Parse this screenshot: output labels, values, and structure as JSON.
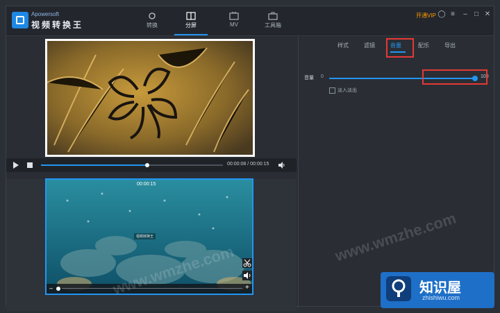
{
  "app": {
    "brand": "Apowersoft",
    "name": "视频转换王"
  },
  "tabs": [
    {
      "label": "转换",
      "active": false
    },
    {
      "label": "分屏",
      "active": true
    },
    {
      "label": "MV",
      "active": false
    },
    {
      "label": "工具箱",
      "active": false
    }
  ],
  "vip_label": "开通VIP",
  "player": {
    "time": "00:00:08 / 00:00:15"
  },
  "clip2": {
    "duration": "00:00:15",
    "mini_label": "视频转换王"
  },
  "subtabs": [
    {
      "label": "样式",
      "active": false
    },
    {
      "label": "滤镜",
      "active": false
    },
    {
      "label": "音量",
      "active": true
    },
    {
      "label": "配乐",
      "active": false
    },
    {
      "label": "导出",
      "active": false
    }
  ],
  "volume": {
    "label": "音量",
    "min": "0",
    "max": "100",
    "value": 100
  },
  "fade_label": "淡入淡出",
  "watermark": "www.wmzhe.com",
  "site_badge": {
    "title": "知识屋",
    "url": "zhishiwu.com"
  },
  "colors": {
    "accent": "#2196f3",
    "vip": "#ff9800",
    "highlight": "#e53935"
  }
}
